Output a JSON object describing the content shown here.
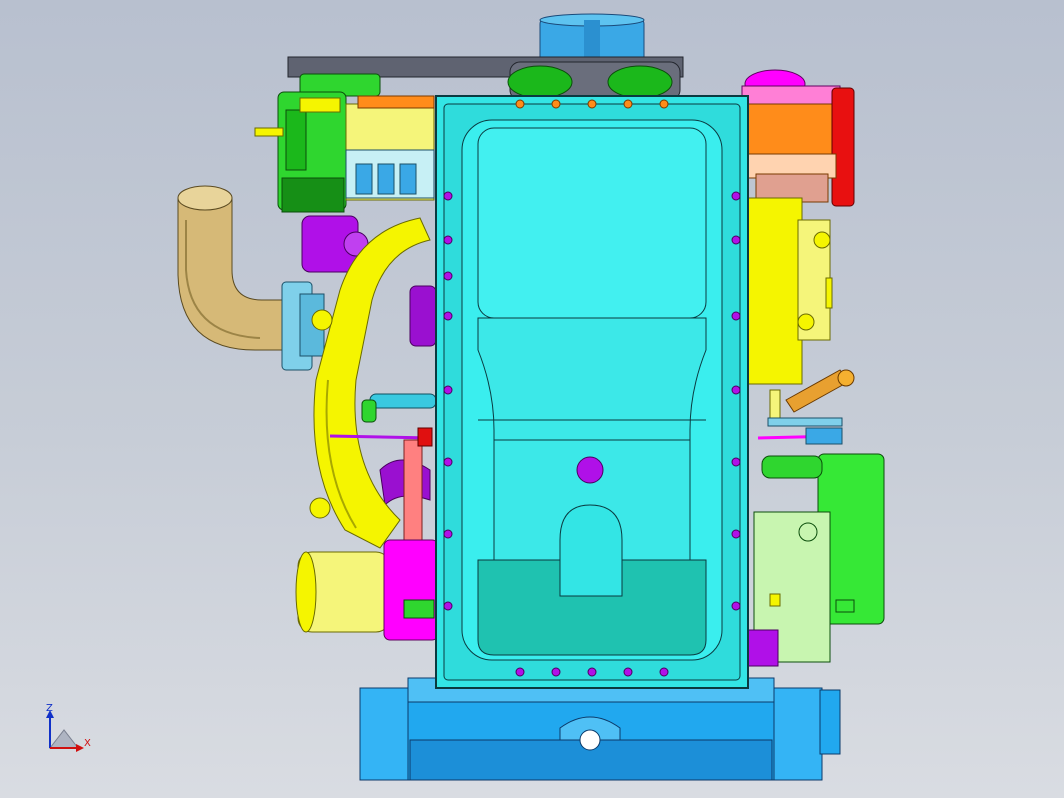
{
  "viewport": {
    "background_top": "#b8c0cf",
    "background_bottom": "#d9dce2"
  },
  "model": {
    "subject": "engine-assembly-front-view",
    "palette": {
      "oil_pan": "#33e5e5",
      "base": "#21a8ef",
      "pulley": "#3aa8e6",
      "belt": "#5f6371",
      "intake_tube": "#d6b977",
      "yellow_parts": "#f5f500",
      "magenta_parts": "#ff00ff",
      "purple_parts": "#b010e8",
      "green_parts": "#19e019",
      "orange_parts": "#ff8c1a",
      "starter": "#36e836"
    },
    "icons": [
      "bolt-icon",
      "oil-drain-plug-icon"
    ]
  },
  "triad": {
    "z_label": "Z",
    "x_label": "X",
    "z_color": "#1030c8",
    "x_color": "#d01010"
  }
}
